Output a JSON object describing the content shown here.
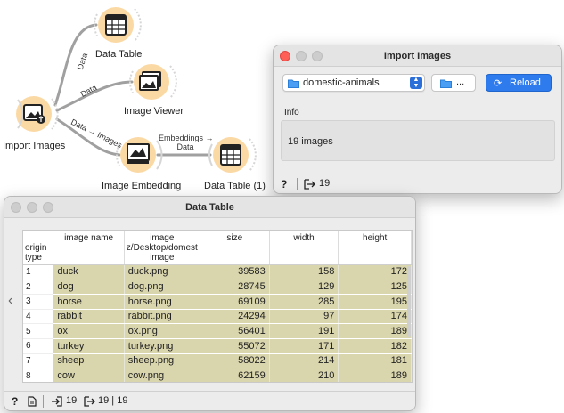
{
  "workflow": {
    "nodes": {
      "import_images": "Import Images",
      "data_table": "Data Table",
      "image_viewer": "Image Viewer",
      "image_embedding": "Image Embedding",
      "data_table_1": "Data Table (1)"
    },
    "links": {
      "data_upper": "Data",
      "data_mid": "Data",
      "data_images": "Data → Images",
      "embeddings_line1": "Embeddings →",
      "embeddings_line2": "Data"
    }
  },
  "import_window": {
    "title": "Import Images",
    "folder_value": "domestic-animals",
    "browse_label": "...",
    "reload_label": "Reload",
    "info_label": "Info",
    "info_text": "19 images",
    "status_help": "?",
    "status_output": "19"
  },
  "table_window": {
    "title": "Data Table",
    "columns": [
      "image name",
      "image",
      "size",
      "width",
      "height"
    ],
    "image_col_path": "z/Desktop/domest",
    "image_col_sub": "image",
    "corner_label_1": "origin",
    "corner_label_2": "type",
    "rows": [
      {
        "i": "1",
        "name": "duck",
        "image": "duck.png",
        "size": "39583",
        "width": "158",
        "height": "172"
      },
      {
        "i": "2",
        "name": "dog",
        "image": "dog.png",
        "size": "28745",
        "width": "129",
        "height": "125"
      },
      {
        "i": "3",
        "name": "horse",
        "image": "horse.png",
        "size": "69109",
        "width": "285",
        "height": "195"
      },
      {
        "i": "4",
        "name": "rabbit",
        "image": "rabbit.png",
        "size": "24294",
        "width": "97",
        "height": "174"
      },
      {
        "i": "5",
        "name": "ox",
        "image": "ox.png",
        "size": "56401",
        "width": "191",
        "height": "189"
      },
      {
        "i": "6",
        "name": "turkey",
        "image": "turkey.png",
        "size": "55072",
        "width": "171",
        "height": "182"
      },
      {
        "i": "7",
        "name": "sheep",
        "image": "sheep.png",
        "size": "58022",
        "width": "214",
        "height": "181"
      },
      {
        "i": "8",
        "name": "cow",
        "image": "cow.png",
        "size": "62159",
        "width": "210",
        "height": "189"
      }
    ],
    "status_help": "?",
    "status_input": "19",
    "status_output": "19 | 19"
  },
  "colors": {
    "node_fill": "#fbd9a5",
    "link_color": "#9a9a9a",
    "cell_bg": "#d9d5ac",
    "reload_bg": "#2e7bee",
    "close_red": "#fe5f57"
  }
}
